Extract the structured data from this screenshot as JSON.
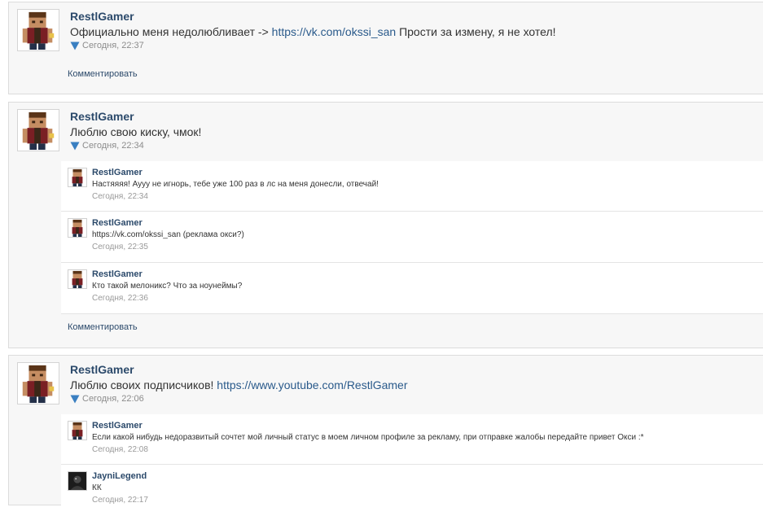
{
  "posts": [
    {
      "author": "RestlGamer",
      "text_before": "Официально меня недолюбливает -> ",
      "link": "https://vk.com/okssi_san",
      "text_after": " Прости за измену, я не хотел!",
      "time": "Сегодня, 22:37",
      "comment_action": "Комментировать"
    },
    {
      "author": "RestlGamer",
      "text_before": "Люблю свою киску, чмок!",
      "link": "",
      "text_after": "",
      "time": "Сегодня, 22:34",
      "comment_action": "Комментировать",
      "comments": [
        {
          "author": "RestlGamer",
          "text": "Настяяяя! Ауyy не игнорь, тебе уже 100 раз в лс на меня донесли, отвечай!",
          "time": "Сегодня, 22:34"
        },
        {
          "author": "RestlGamer",
          "text": "https://vk.com/okssi_san (реклама окси?)",
          "time": "Сегодня, 22:35"
        },
        {
          "author": "RestlGamer",
          "text": "Кто такой мелоникс? Что за ноунеймы?",
          "time": "Сегодня, 22:36"
        }
      ]
    },
    {
      "author": "RestlGamer",
      "text_before": "Люблю своих подписчиков! ",
      "link": "https://www.youtube.com/RestlGamer",
      "text_after": "",
      "time": "Сегодня, 22:06",
      "comments": [
        {
          "author": "RestlGamer",
          "text": "Если какой нибудь недоразвитый сочтет мой личный статус в моем личном профиле за рекламу, при отправке жалобы передайте привет Окси :*",
          "time": "Сегодня, 22:08"
        },
        {
          "author": "JayniLegend",
          "text": "КК",
          "time": "Сегодня, 22:17"
        }
      ]
    }
  ],
  "icons": {
    "expand": "triangle-down-icon",
    "avatar_restl": "minecraft-avatar-icon",
    "avatar_jayni": "dark-avatar-icon"
  },
  "colors": {
    "author": "#2c4a6b",
    "link": "#2a5a8b",
    "meta": "#8c8c8c",
    "triangle": "#3a7fc1",
    "post_background": "#f7f7f7"
  }
}
